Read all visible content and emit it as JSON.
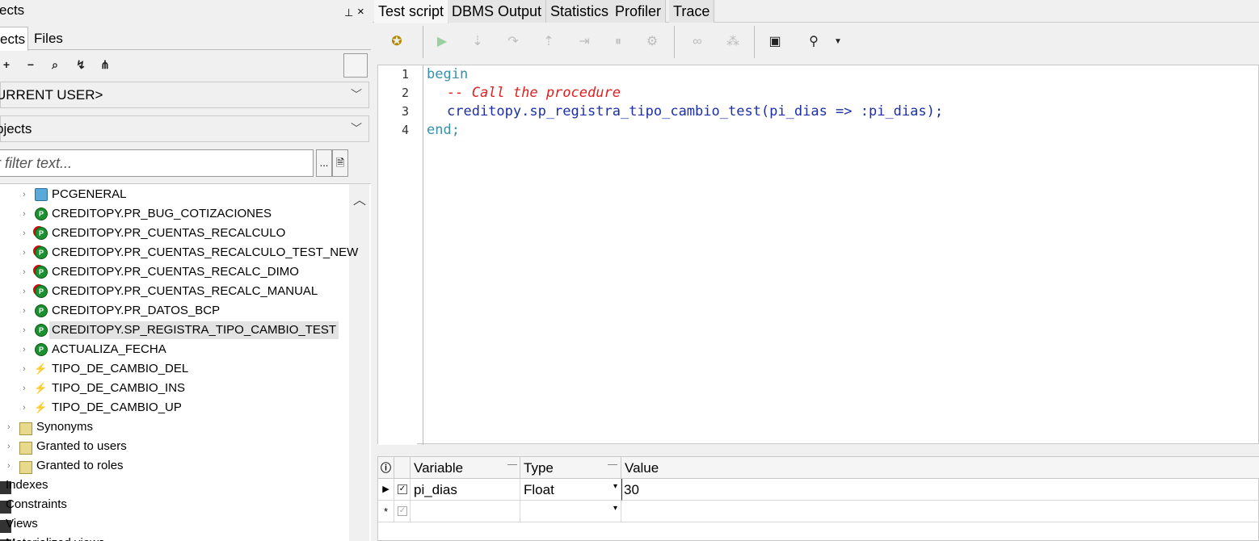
{
  "left": {
    "title": "ects",
    "tabs": [
      "ects",
      "Files"
    ],
    "owner_combo": "URRENT USER>",
    "type_combo": "bjects",
    "filter_placeholder": "er filter text...",
    "filter_btn": "...",
    "tree": [
      {
        "label": "PCGENERAL",
        "icon": "package-icon"
      },
      {
        "label": "CREDITOPY.PR_BUG_COTIZACIONES",
        "icon": "procedure-icon"
      },
      {
        "label": "CREDITOPY.PR_CUENTAS_RECALCULO",
        "icon": "procedure-invalid-icon"
      },
      {
        "label": "CREDITOPY.PR_CUENTAS_RECALCULO_TEST_NEW",
        "icon": "procedure-invalid-icon"
      },
      {
        "label": "CREDITOPY.PR_CUENTAS_RECALC_DIMO",
        "icon": "procedure-invalid-icon"
      },
      {
        "label": "CREDITOPY.PR_CUENTAS_RECALC_MANUAL",
        "icon": "procedure-invalid-icon"
      },
      {
        "label": "CREDITOPY.PR_DATOS_BCP",
        "icon": "procedure-icon"
      },
      {
        "label": "CREDITOPY.SP_REGISTRA_TIPO_CAMBIO_TEST",
        "icon": "procedure-icon",
        "selected": true
      },
      {
        "label": "ACTUALIZA_FECHA",
        "icon": "procedure-icon"
      },
      {
        "label": "TIPO_DE_CAMBIO_DEL",
        "icon": "trigger-icon"
      },
      {
        "label": "TIPO_DE_CAMBIO_INS",
        "icon": "trigger-icon"
      },
      {
        "label": "TIPO_DE_CAMBIO_UP",
        "icon": "trigger-icon"
      }
    ],
    "folders": [
      "Synonyms",
      "Granted to users",
      "Granted to roles"
    ],
    "categories": [
      "Indexes",
      "Constraints",
      "Views",
      "Materialized views"
    ]
  },
  "right": {
    "tabs": [
      "Test script",
      "DBMS Output",
      "Statistics",
      "Profiler",
      "Trace"
    ],
    "code": {
      "line_numbers": [
        "1",
        "2",
        "3",
        "4"
      ],
      "l1": "begin",
      "l2": "-- Call the procedure",
      "l3": "creditopy.sp_registra_tipo_cambio_test(pi_dias => :pi_dias);",
      "l4": "end;"
    },
    "grid": {
      "headers": [
        "Variable",
        "Type",
        "Value"
      ],
      "rows": [
        {
          "variable": "pi_dias",
          "type": "Float",
          "value": "30"
        }
      ]
    }
  }
}
